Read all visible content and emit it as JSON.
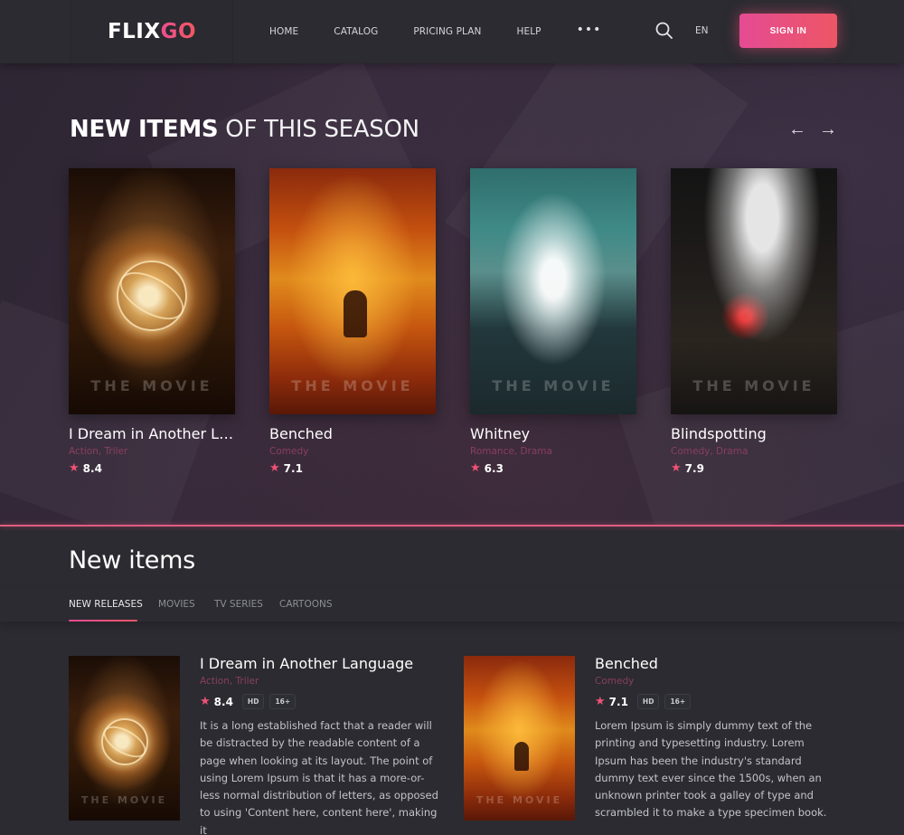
{
  "header": {
    "logo_part1": "FLIX",
    "logo_part2": "GO",
    "nav": [
      "HOME",
      "CATALOG",
      "PRICING PLAN",
      "HELP"
    ],
    "more_icon": "•••",
    "search_icon": "search-icon",
    "language": "EN",
    "signin_label": "SIGN IN"
  },
  "hero": {
    "title_bold": "NEW ITEMS",
    "title_rest": " OF THIS SEASON",
    "prev_icon": "←",
    "next_icon": "→",
    "watermark": "THE MOVIE",
    "cards": [
      {
        "title": "I Dream in Another Language",
        "genre": "Action, Triler",
        "rating": "8.4"
      },
      {
        "title": "Benched",
        "genre": "Comedy",
        "rating": "7.1"
      },
      {
        "title": "Whitney",
        "genre": "Romance, Drama",
        "rating": "6.3"
      },
      {
        "title": "Blindspotting",
        "genre": "Comedy, Drama",
        "rating": "7.9"
      }
    ]
  },
  "new_items": {
    "title": "New items",
    "tabs": [
      "NEW RELEASES",
      "MOVIES",
      "TV SERIES",
      "CARTOONS"
    ],
    "active_tab": "NEW RELEASES",
    "items": [
      {
        "title": "I Dream in Another Language",
        "genre": "Action, Triler",
        "rating": "8.4",
        "badges": [
          "HD",
          "16+"
        ],
        "description": "It is a long established fact that a reader will be distracted by the readable content of a page when looking at its layout. The point of using Lorem Ipsum is that it has a more-or-less normal distribution of letters, as opposed to using 'Content here, content here', making it"
      },
      {
        "title": "Benched",
        "genre": "Comedy",
        "rating": "7.1",
        "badges": [
          "HD",
          "16+"
        ],
        "description": "Lorem Ipsum is simply dummy text of the printing and typesetting industry. Lorem Ipsum has been the industry's standard dummy text ever since the 1500s, when an unknown printer took a galley of type and scrambled it to make a type specimen book."
      }
    ]
  },
  "colors": {
    "accent_start": "#e54b93",
    "accent_end": "#ed5665",
    "background": "#2b2b31",
    "genre_text": "#8a3e5e",
    "star": "#ee5275"
  }
}
